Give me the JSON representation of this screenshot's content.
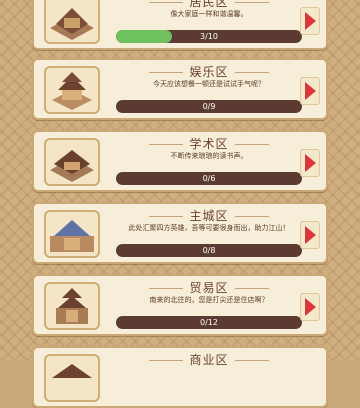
{
  "districts": [
    {
      "title": "居民区",
      "desc": "像大家庭一样和谐温馨。",
      "progress_text": "3/10",
      "progress": 0.3
    },
    {
      "title": "娱乐区",
      "desc": "今天应该想餐一顿还是试试手气呢？",
      "progress_text": "0/9",
      "progress": 0
    },
    {
      "title": "学术区",
      "desc": "不断传来琅琅的读书声。",
      "progress_text": "0/6",
      "progress": 0
    },
    {
      "title": "主城区",
      "desc": "此处汇聚四方英雄，吾等可要很身而出，助力江山！",
      "progress_text": "0/8",
      "progress": 0
    },
    {
      "title": "贸易区",
      "desc": "南来的北往的，您是打尖还是住店啊？",
      "progress_text": "0/12",
      "progress": 0
    },
    {
      "title": "商业区",
      "desc": "",
      "progress_text": "",
      "progress": 0
    }
  ],
  "colors": {
    "accent_arrow": "#d8373b",
    "progress_fill": "#6fc05f",
    "bar_bg": "#5b3a31"
  }
}
